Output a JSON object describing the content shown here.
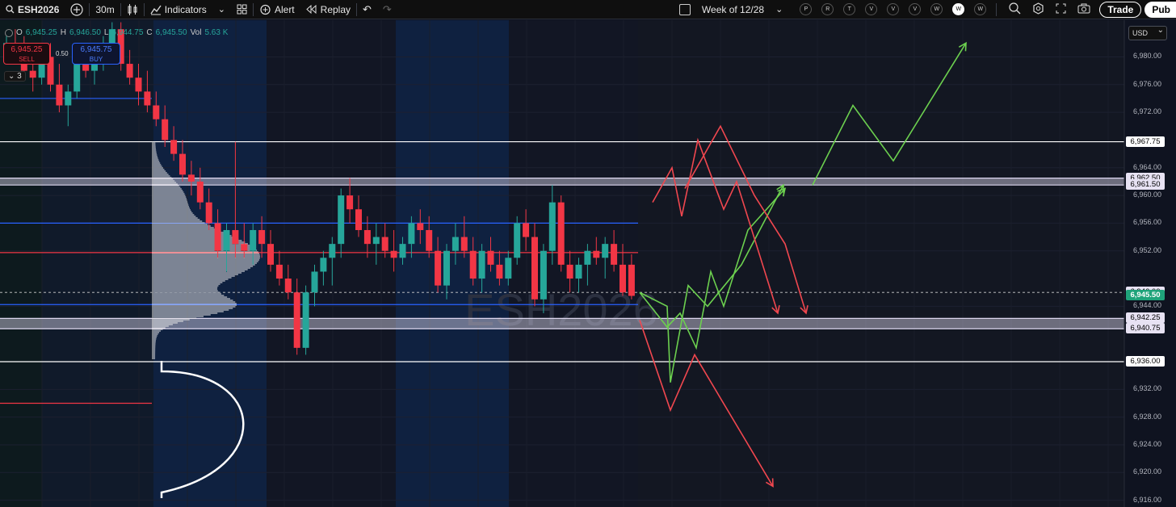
{
  "toolbar": {
    "symbol": "ESH2026",
    "interval": "30m",
    "indicators_label": "Indicators",
    "alert_label": "Alert",
    "replay_label": "Replay",
    "range_label": "Week of 12/28",
    "days": [
      {
        "label": "P",
        "active": false
      },
      {
        "label": "R",
        "active": false
      },
      {
        "label": "T",
        "active": false
      },
      {
        "label": "V",
        "active": false
      },
      {
        "label": "V",
        "active": false
      },
      {
        "label": "V",
        "active": false
      },
      {
        "label": "W",
        "active": false
      },
      {
        "label": "W",
        "active": true
      },
      {
        "label": "W",
        "active": false
      }
    ],
    "trade_label": "Trade",
    "publish_label": "Pub"
  },
  "legend": {
    "o_label": "O",
    "o_value": "6,945.25",
    "h_label": "H",
    "h_value": "6,946.50",
    "l_label": "L",
    "l_value": "6,944.75",
    "c_label": "C",
    "c_value": "6,945.50",
    "vol_label": "Vol",
    "vol_value": "5.63 K"
  },
  "trade_panel": {
    "sell_price": "6,945.25",
    "sell_label": "SELL",
    "buy_price": "6,945.75",
    "buy_label": "BUY",
    "spread": "0.50",
    "collapse_count": "3"
  },
  "currency": "USD",
  "watermark": "ESH2026",
  "colors": {
    "up": "#26a69a",
    "down": "#f23645",
    "blue_line": "#2962ff",
    "green_projection": "#6cd04f",
    "red_projection": "#f0474f"
  },
  "price_ticks": [
    "6,980.00",
    "6,976.00",
    "6,972.00",
    "6,964.00",
    "6,960.00",
    "6,956.00",
    "6,952.00",
    "6,944.00",
    "6,932.00",
    "6,928.00",
    "6,924.00",
    "6,920.00",
    "6,916.00"
  ],
  "price_labels": [
    {
      "text": "6,967.75",
      "style": "white"
    },
    {
      "text": "6,962.50",
      "style": "lav"
    },
    {
      "text": "6,961.50",
      "style": "lav"
    },
    {
      "text": "6,946.00",
      "style": "lav"
    },
    {
      "text": "6,945.50",
      "style": "green"
    },
    {
      "text": "6,942.25",
      "style": "lav"
    },
    {
      "text": "6,940.75",
      "style": "lav"
    },
    {
      "text": "6,936.00",
      "style": "white"
    }
  ],
  "chart_data": {
    "type": "candlestick",
    "y_unit": "price",
    "ylim": [
      6915,
      6985
    ],
    "horizontal_levels": [
      {
        "price": 6967.75,
        "color": "white"
      },
      {
        "price": 6962.5,
        "color": "lavender"
      },
      {
        "price": 6961.5,
        "color": "lavender"
      },
      {
        "price": 6942.25,
        "color": "lavender"
      },
      {
        "price": 6940.75,
        "color": "lavender"
      },
      {
        "price": 6936.0,
        "color": "white"
      },
      {
        "price": 6974.0,
        "color": "blue"
      },
      {
        "price": 6956.0,
        "color": "blue"
      },
      {
        "price": 6951.75,
        "color": "red"
      },
      {
        "price": 6944.25,
        "color": "blue"
      },
      {
        "price": 6930.0,
        "color": "red"
      }
    ],
    "candles": [
      {
        "o": 6980.5,
        "h": 6983,
        "l": 6979,
        "c": 6982
      },
      {
        "o": 6982,
        "h": 6984,
        "l": 6980,
        "c": 6981
      },
      {
        "o": 6981,
        "h": 6983,
        "l": 6977,
        "c": 6978
      },
      {
        "o": 6978,
        "h": 6980,
        "l": 6975,
        "c": 6977
      },
      {
        "o": 6977,
        "h": 6981,
        "l": 6976,
        "c": 6980
      },
      {
        "o": 6980,
        "h": 6982,
        "l": 6975,
        "c": 6976
      },
      {
        "o": 6976,
        "h": 6979,
        "l": 6972,
        "c": 6973
      },
      {
        "o": 6973,
        "h": 6976,
        "l": 6970,
        "c": 6975
      },
      {
        "o": 6975,
        "h": 6980,
        "l": 6974,
        "c": 6979
      },
      {
        "o": 6979,
        "h": 6981,
        "l": 6977,
        "c": 6978
      },
      {
        "o": 6978,
        "h": 6980,
        "l": 6976,
        "c": 6979
      },
      {
        "o": 6979,
        "h": 6983,
        "l": 6978,
        "c": 6982
      },
      {
        "o": 6982,
        "h": 6985,
        "l": 6980,
        "c": 6984
      },
      {
        "o": 6984,
        "h": 6985,
        "l": 6978,
        "c": 6979
      },
      {
        "o": 6979,
        "h": 6981,
        "l": 6976,
        "c": 6977
      },
      {
        "o": 6977,
        "h": 6979,
        "l": 6973,
        "c": 6975
      },
      {
        "o": 6975,
        "h": 6978,
        "l": 6972,
        "c": 6973
      },
      {
        "o": 6973,
        "h": 6975,
        "l": 6970,
        "c": 6971
      },
      {
        "o": 6971,
        "h": 6973,
        "l": 6967,
        "c": 6968
      },
      {
        "o": 6968,
        "h": 6970,
        "l": 6965,
        "c": 6966
      },
      {
        "o": 6966,
        "h": 6968,
        "l": 6962,
        "c": 6963
      },
      {
        "o": 6963,
        "h": 6965,
        "l": 6960,
        "c": 6962
      },
      {
        "o": 6962,
        "h": 6964,
        "l": 6958,
        "c": 6959
      },
      {
        "o": 6959,
        "h": 6961,
        "l": 6955,
        "c": 6956
      },
      {
        "o": 6956,
        "h": 6958,
        "l": 6951,
        "c": 6952
      },
      {
        "o": 6952,
        "h": 6956,
        "l": 6949,
        "c": 6955
      },
      {
        "o": 6955,
        "h": 6967.75,
        "l": 6951,
        "c": 6953
      },
      {
        "o": 6953,
        "h": 6956,
        "l": 6951,
        "c": 6952
      },
      {
        "o": 6952,
        "h": 6956,
        "l": 6950,
        "c": 6955
      },
      {
        "o": 6955,
        "h": 6957,
        "l": 6951,
        "c": 6953
      },
      {
        "o": 6953,
        "h": 6955,
        "l": 6949,
        "c": 6950
      },
      {
        "o": 6950,
        "h": 6952,
        "l": 6947,
        "c": 6948
      },
      {
        "o": 6948,
        "h": 6950,
        "l": 6945,
        "c": 6946
      },
      {
        "o": 6946,
        "h": 6948,
        "l": 6937,
        "c": 6938
      },
      {
        "o": 6938,
        "h": 6947,
        "l": 6937,
        "c": 6946
      },
      {
        "o": 6946,
        "h": 6950,
        "l": 6944,
        "c": 6949
      },
      {
        "o": 6949,
        "h": 6952,
        "l": 6947,
        "c": 6951
      },
      {
        "o": 6951,
        "h": 6954,
        "l": 6947,
        "c": 6953
      },
      {
        "o": 6953,
        "h": 6961,
        "l": 6951,
        "c": 6960
      },
      {
        "o": 6960,
        "h": 6962.5,
        "l": 6956,
        "c": 6958
      },
      {
        "o": 6958,
        "h": 6960,
        "l": 6954,
        "c": 6955
      },
      {
        "o": 6955,
        "h": 6957,
        "l": 6951,
        "c": 6953
      },
      {
        "o": 6953,
        "h": 6956,
        "l": 6950,
        "c": 6954
      },
      {
        "o": 6954,
        "h": 6956,
        "l": 6951,
        "c": 6952
      },
      {
        "o": 6952,
        "h": 6955,
        "l": 6949,
        "c": 6951
      },
      {
        "o": 6951,
        "h": 6954,
        "l": 6950,
        "c": 6953
      },
      {
        "o": 6953,
        "h": 6957,
        "l": 6951,
        "c": 6956
      },
      {
        "o": 6956,
        "h": 6958,
        "l": 6953,
        "c": 6955
      },
      {
        "o": 6955,
        "h": 6957,
        "l": 6951,
        "c": 6952
      },
      {
        "o": 6952,
        "h": 6954,
        "l": 6946,
        "c": 6947
      },
      {
        "o": 6947,
        "h": 6953,
        "l": 6945,
        "c": 6952
      },
      {
        "o": 6952,
        "h": 6956,
        "l": 6950,
        "c": 6954
      },
      {
        "o": 6954,
        "h": 6957,
        "l": 6951,
        "c": 6952
      },
      {
        "o": 6952,
        "h": 6954,
        "l": 6947,
        "c": 6948
      },
      {
        "o": 6948,
        "h": 6953,
        "l": 6946,
        "c": 6952
      },
      {
        "o": 6952,
        "h": 6954,
        "l": 6949,
        "c": 6950
      },
      {
        "o": 6950,
        "h": 6952,
        "l": 6947,
        "c": 6948
      },
      {
        "o": 6948,
        "h": 6952,
        "l": 6947,
        "c": 6951
      },
      {
        "o": 6951,
        "h": 6957,
        "l": 6950,
        "c": 6956
      },
      {
        "o": 6956,
        "h": 6958,
        "l": 6952,
        "c": 6954
      },
      {
        "o": 6954,
        "h": 6956,
        "l": 6944,
        "c": 6945
      },
      {
        "o": 6945,
        "h": 6953,
        "l": 6943,
        "c": 6952
      },
      {
        "o": 6952,
        "h": 6961.5,
        "l": 6950,
        "c": 6959
      },
      {
        "o": 6959,
        "h": 6960,
        "l": 6949,
        "c": 6950
      },
      {
        "o": 6950,
        "h": 6952,
        "l": 6946,
        "c": 6948
      },
      {
        "o": 6948,
        "h": 6951,
        "l": 6946,
        "c": 6950
      },
      {
        "o": 6950,
        "h": 6953,
        "l": 6947,
        "c": 6952
      },
      {
        "o": 6952,
        "h": 6954,
        "l": 6950,
        "c": 6951
      },
      {
        "o": 6951,
        "h": 6954,
        "l": 6948,
        "c": 6953
      },
      {
        "o": 6953,
        "h": 6955,
        "l": 6949,
        "c": 6950
      },
      {
        "o": 6950,
        "h": 6953,
        "l": 6945.5,
        "c": 6946
      },
      {
        "o": 6950,
        "h": 6951.5,
        "l": 6945,
        "c": 6945.5
      }
    ],
    "projections": [
      {
        "color": "green",
        "points": [
          [
            6946,
            0
          ],
          [
            6941,
            1
          ],
          [
            6943,
            2
          ],
          [
            6938,
            3
          ],
          [
            6949,
            4
          ],
          [
            6944,
            5
          ],
          [
            6955,
            6
          ],
          [
            6961,
            7
          ]
        ]
      },
      {
        "color": "green",
        "points": [
          [
            6946,
            0
          ],
          [
            6944,
            1
          ],
          [
            6933,
            2
          ],
          [
            6947,
            3
          ],
          [
            6944,
            4
          ],
          [
            6950,
            5
          ],
          [
            6961.5,
            6
          ]
        ]
      },
      {
        "color": "green",
        "points": [
          [
            6961.5,
            0
          ],
          [
            6973,
            1
          ],
          [
            6965,
            2
          ],
          [
            6982,
            3
          ]
        ]
      },
      {
        "color": "red",
        "points": [
          [
            6959,
            0
          ],
          [
            6964,
            1
          ],
          [
            6957,
            2
          ],
          [
            6968,
            3
          ],
          [
            6958,
            4
          ],
          [
            6962,
            5
          ],
          [
            6943,
            6
          ]
        ]
      },
      {
        "color": "red",
        "points": [
          [
            6961,
            0
          ],
          [
            6970,
            1
          ],
          [
            6960,
            2
          ],
          [
            6953,
            3
          ],
          [
            6943,
            4
          ]
        ]
      },
      {
        "color": "red",
        "points": [
          [
            6942,
            0
          ],
          [
            6929,
            1
          ],
          [
            6937,
            2
          ],
          [
            6918,
            3
          ]
        ]
      }
    ]
  }
}
